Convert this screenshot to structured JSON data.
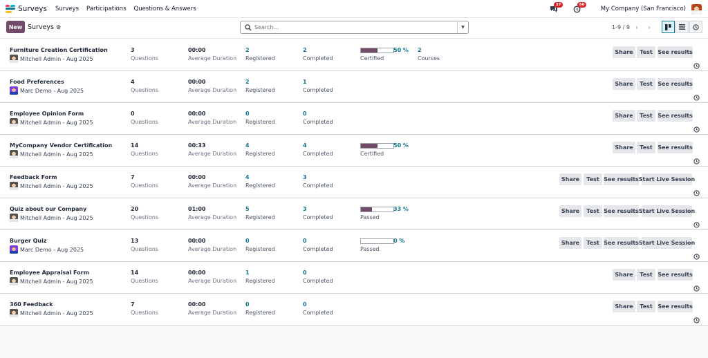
{
  "topbar": {
    "app_name": "Surveys",
    "menu": [
      "Surveys",
      "Participations",
      "Questions & Answers"
    ],
    "messages_badge": "37",
    "activities_badge": "66",
    "company": "My Company (San Francisco)"
  },
  "control": {
    "new_label": "New",
    "breadcrumb": "Surveys",
    "search_placeholder": "Search...",
    "pager": "1-9 / 9"
  },
  "colors": {
    "brand": "#714b67",
    "teal": "#0e7490",
    "badge": "#dc2626"
  },
  "labels": {
    "questions": "Questions",
    "average_duration": "Average Duration",
    "registered": "Registered",
    "completed": "Completed",
    "courses": "Courses",
    "share": "Share",
    "test": "Test",
    "see_results": "See results",
    "start_live": "Start Live Session"
  },
  "rows": [
    {
      "title": "Furniture Creation Certification",
      "author": "Mitchell Admin - Aug 2025",
      "avatar": "mitchell",
      "questions": "3",
      "duration": "00:00",
      "registered": "2",
      "completed": "2",
      "progress": 50,
      "pct": "50 %",
      "result_label": "Certified",
      "courses": "2",
      "live": false
    },
    {
      "title": "Food Preferences",
      "author": "Marc Demo - Aug 2025",
      "avatar": "marc",
      "questions": "4",
      "duration": "00:00",
      "registered": "2",
      "completed": "1",
      "live": false
    },
    {
      "title": "Employee Opinion Form",
      "author": "Mitchell Admin - Aug 2025",
      "avatar": "mitchell",
      "questions": "0",
      "duration": "00:00",
      "registered": "0",
      "completed": "0",
      "live": false
    },
    {
      "title": "MyCompany Vendor Certification",
      "author": "Mitchell Admin - Aug 2025",
      "avatar": "mitchell",
      "questions": "14",
      "duration": "00:33",
      "registered": "4",
      "completed": "4",
      "progress": 50,
      "pct": "50 %",
      "result_label": "Certified",
      "live": false
    },
    {
      "title": "Feedback Form",
      "author": "Mitchell Admin - Aug 2025",
      "avatar": "mitchell",
      "questions": "7",
      "duration": "00:00",
      "registered": "4",
      "completed": "3",
      "live": true
    },
    {
      "title": "Quiz about our Company",
      "author": "Mitchell Admin - Aug 2025",
      "avatar": "mitchell",
      "questions": "20",
      "duration": "01:00",
      "registered": "5",
      "completed": "3",
      "progress": 33,
      "pct": "33 %",
      "result_label": "Passed",
      "live": true
    },
    {
      "title": "Burger Quiz",
      "author": "Marc Demo - Aug 2025",
      "avatar": "marc",
      "questions": "13",
      "duration": "00:00",
      "registered": "0",
      "completed": "0",
      "progress": 0,
      "pct": "0 %",
      "result_label": "Passed",
      "live": true
    },
    {
      "title": "Employee Appraisal Form",
      "author": "Mitchell Admin - Aug 2025",
      "avatar": "mitchell",
      "questions": "14",
      "duration": "00:00",
      "registered": "1",
      "completed": "0",
      "live": false
    },
    {
      "title": "360 Feedback",
      "author": "Mitchell Admin - Aug 2025",
      "avatar": "mitchell",
      "questions": "7",
      "duration": "00:00",
      "registered": "0",
      "completed": "0",
      "live": false
    }
  ]
}
